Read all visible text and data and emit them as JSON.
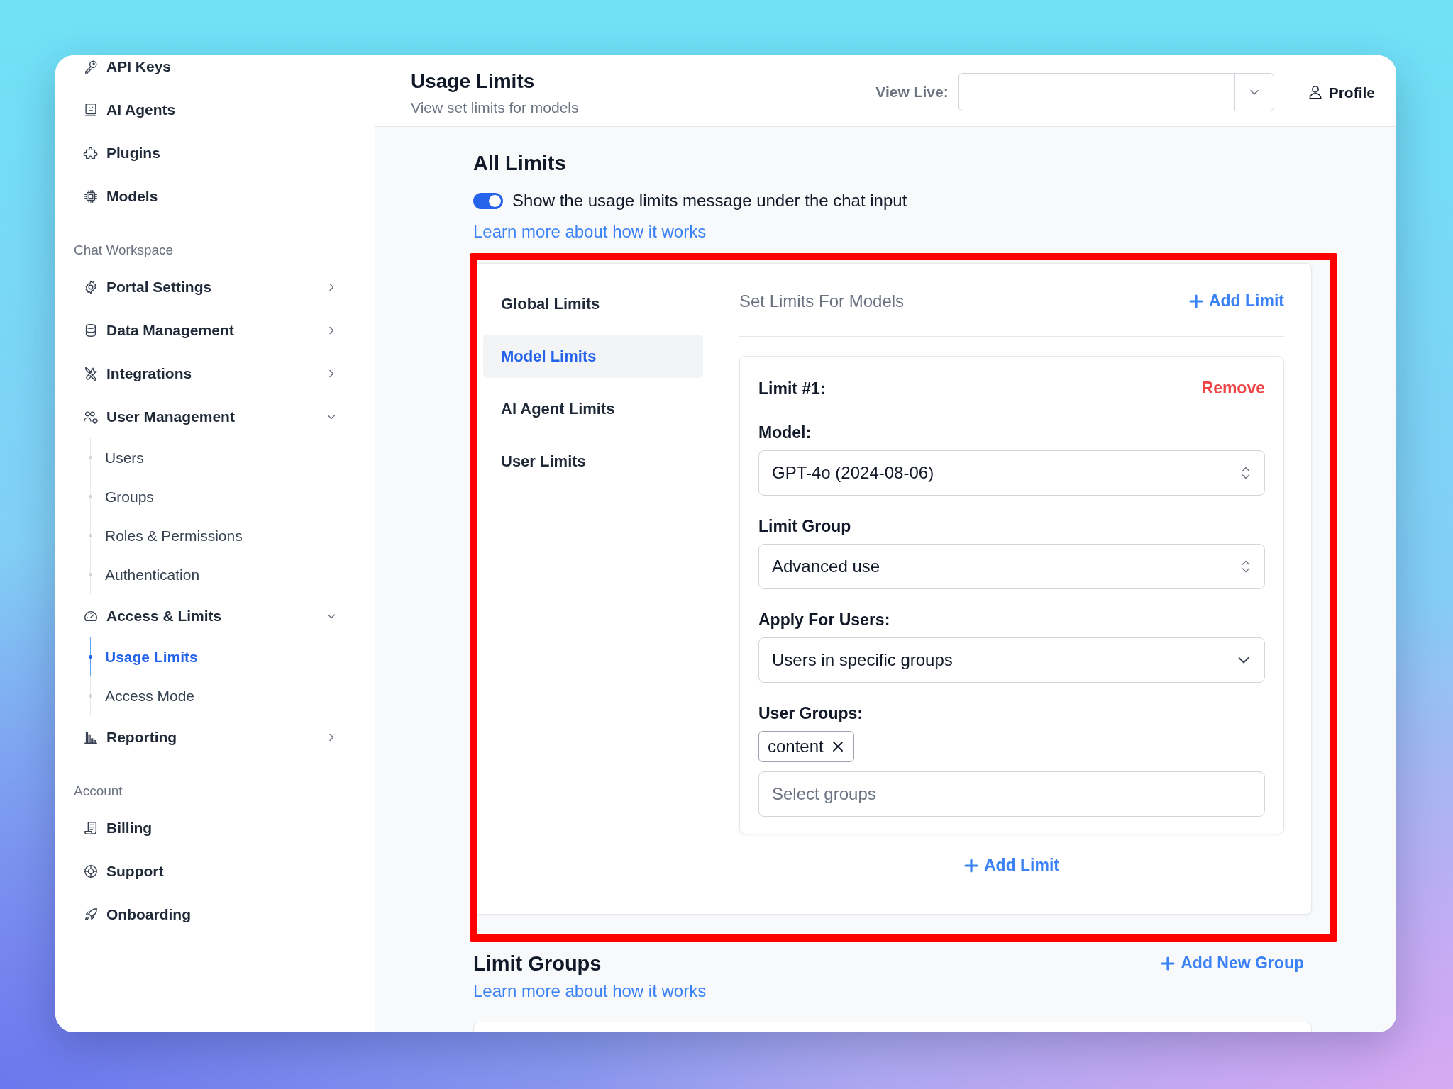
{
  "sidebar": {
    "groups": [
      {
        "items": [
          {
            "label": "API Keys",
            "selected": false
          },
          {
            "label": "AI Agents",
            "selected": false
          },
          {
            "label": "Plugins",
            "selected": false
          },
          {
            "label": "Models",
            "selected": false
          }
        ]
      },
      {
        "heading": "Chat Workspace",
        "items": [
          {
            "label": "Portal Settings",
            "expanded": false
          },
          {
            "label": "Data Management",
            "expanded": false
          },
          {
            "label": "Integrations",
            "expanded": false
          },
          {
            "label": "User Management",
            "expanded": true,
            "children": [
              {
                "label": "Users",
                "selected": false
              },
              {
                "label": "Groups",
                "selected": false
              },
              {
                "label": "Roles & Permissions",
                "selected": false
              },
              {
                "label": "Authentication",
                "selected": false
              }
            ]
          },
          {
            "label": "Access & Limits",
            "expanded": true,
            "children": [
              {
                "label": "Usage Limits",
                "selected": true
              },
              {
                "label": "Access Mode",
                "selected": false
              }
            ]
          },
          {
            "label": "Reporting",
            "expanded": false
          }
        ]
      },
      {
        "heading": "Account",
        "items": [
          {
            "label": "Billing",
            "selected": false
          },
          {
            "label": "Support",
            "selected": false
          },
          {
            "label": "Onboarding",
            "selected": false
          }
        ]
      }
    ]
  },
  "header": {
    "title": "Usage Limits",
    "subtitle": "View set limits for models",
    "view_live_label": "View Live:",
    "profile": "Profile"
  },
  "all_limits": {
    "title": "All Limits",
    "toggle": {
      "label": "Show the usage limits message under the chat input",
      "on": true
    },
    "link": "Learn more about how it works",
    "panel": {
      "highlighted": true,
      "tabs": [
        {
          "label": "Global Limits",
          "selected": false
        },
        {
          "label": "Model Limits",
          "selected": true
        },
        {
          "label": "AI Agent Limits",
          "selected": false
        },
        {
          "label": "User Limits",
          "selected": false
        }
      ],
      "heading": "Set Limits For Models",
      "add_label": "Add Limit",
      "limits": [
        {
          "title": "Limit #1:",
          "remove_label": "Remove",
          "fields": [
            {
              "kind": "select",
              "label": "Model:",
              "value": "GPT-4o (2024-08-06)"
            },
            {
              "kind": "select",
              "label": "Limit Group",
              "value": "Advanced use"
            },
            {
              "kind": "dropdown",
              "label": "Apply For Users:",
              "value": "Users in specific groups"
            },
            {
              "kind": "tags",
              "label": "User Groups:",
              "tags": [
                "content"
              ],
              "placeholder": "Select groups"
            }
          ]
        }
      ],
      "footer_add_label": "Add Limit"
    }
  },
  "limit_groups": {
    "title": "Limit Groups",
    "add_label": "Add New Group",
    "link": "Learn more about how it works"
  }
}
